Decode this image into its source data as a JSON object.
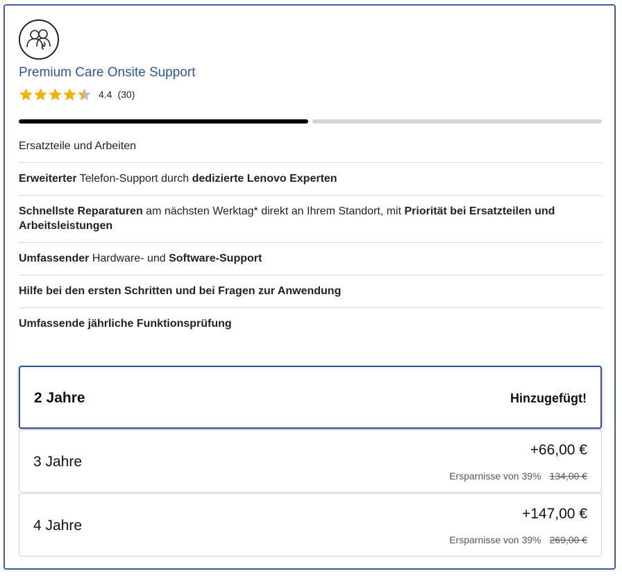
{
  "header": {
    "logo_icon": "support-people-icon",
    "title": "Premium Care Onsite Support",
    "rating_value": "4.4",
    "rating_count": "(30)",
    "rating_stars": 4.4,
    "star_color": "#f5b301"
  },
  "progress": {
    "step": 1,
    "total": 2
  },
  "features": [
    {
      "parts": [
        {
          "t": "Ersatzteile und Arbeiten",
          "b": false
        }
      ]
    },
    {
      "parts": [
        {
          "t": "Erweiterter",
          "b": true
        },
        {
          "t": " Telefon-Support durch ",
          "b": false
        },
        {
          "t": "dedizierte Lenovo Experten",
          "b": true
        }
      ]
    },
    {
      "parts": [
        {
          "t": "Schnellste Reparaturen",
          "b": true
        },
        {
          "t": " am nächsten Werktag* direkt an Ihrem Standort, mit ",
          "b": false
        },
        {
          "t": "Priorität bei Ersatzteilen und Arbeitsleistungen",
          "b": true
        }
      ]
    },
    {
      "parts": [
        {
          "t": "Umfassender",
          "b": true
        },
        {
          "t": " Hardware- und ",
          "b": false
        },
        {
          "t": "Software-Support",
          "b": true
        }
      ]
    },
    {
      "parts": [
        {
          "t": "Hilfe bei den ersten Schritten und bei Fragen zur Anwendung",
          "b": true
        }
      ]
    },
    {
      "parts": [
        {
          "t": "Umfassende jährliche Funktionsprüfung",
          "b": true
        }
      ]
    }
  ],
  "options": [
    {
      "label": "2 Jahre",
      "status": "Hinzugefügt!",
      "selected": true
    },
    {
      "label": "3 Jahre",
      "price": "+66,00 €",
      "savings": "Ersparnisse von 39%",
      "old_price": "134,00 €",
      "selected": false
    },
    {
      "label": "4 Jahre",
      "price": "+147,00 €",
      "savings": "Ersparnisse von 39%",
      "old_price": "269,00 €",
      "selected": false
    }
  ],
  "colors": {
    "accent": "#2f5597",
    "selected_border": "#2f4f9e"
  }
}
